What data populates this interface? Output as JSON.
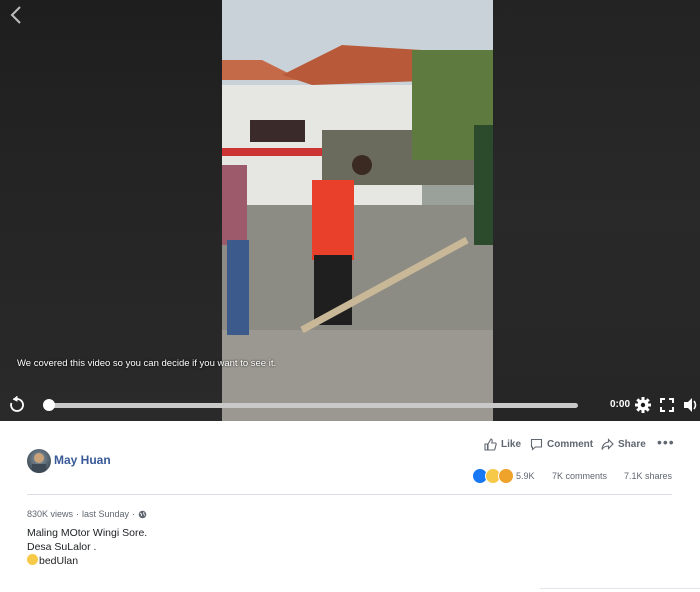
{
  "video": {
    "cover_notice": "We covered this video so you can decide if you want to see it.",
    "time": "0:00",
    "progress": 0
  },
  "post": {
    "author": "May Huan",
    "actions": {
      "like": "Like",
      "comment": "Comment",
      "share": "Share"
    },
    "reactions_count": "5.9K",
    "comments_count": "7K comments",
    "shares_count": "7.1K shares",
    "views": "830K views",
    "separator": "·",
    "posted": "last Sunday",
    "caption_lines": [
      "Maling MOtor Wingi Sore.",
      "Desa SuLalor .",
      "bedUlan"
    ]
  },
  "colors": {
    "link": "#385898",
    "like_blue": "#1877f2",
    "haha_yellow": "#f7c948",
    "angry_orange": "#f0732a"
  },
  "icons": [
    "back-arrow-icon",
    "replay-icon",
    "settings-gear-icon",
    "fullscreen-icon",
    "volume-icon",
    "like-thumb-icon",
    "comment-bubble-icon",
    "share-arrow-icon",
    "more-dots-icon",
    "globe-icon",
    "smile-emoji-icon"
  ]
}
